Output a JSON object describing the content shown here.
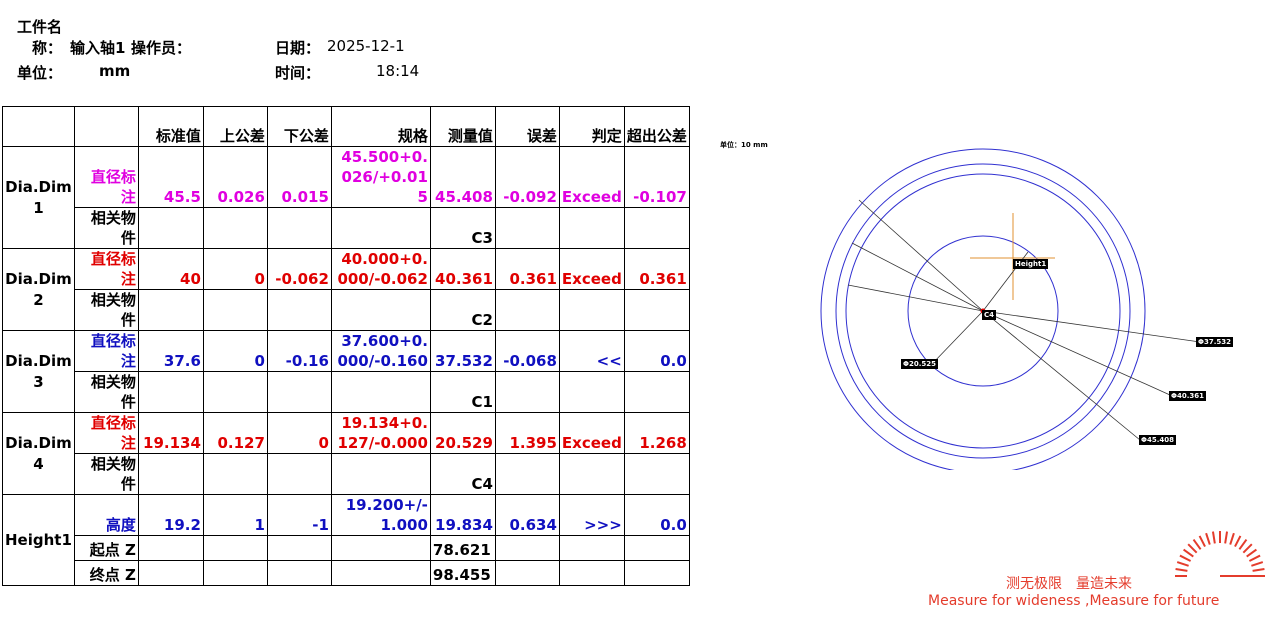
{
  "header": {
    "part_name_label": "工件名",
    "part_name_label2": "称：",
    "part_name": "输入轴1",
    "operator_label": "操作员：",
    "operator": "",
    "date_label": "日期：",
    "date": "2025-12-1",
    "unit_label": "单位：",
    "unit": "mm",
    "time_label": "时间：",
    "time": "18:14"
  },
  "table": {
    "headers": [
      "",
      "",
      "标准值",
      "上公差",
      "下公差",
      "规格",
      "测量值",
      "误差",
      "判定",
      "超出公差"
    ],
    "rows": [
      {
        "name": "Dia.Dim1",
        "label": "直径标注",
        "color": "mag",
        "std": "45.5",
        "up": "0.026",
        "low": "0.015",
        "spec": "45.500+0.026/+0.015",
        "meas": "45.408",
        "err": "-0.092",
        "judge": "Exceed",
        "exceed": "-0.107",
        "rel_label": "相关物件",
        "rel_value": "C3"
      },
      {
        "name": "Dia.Dim2",
        "label": "直径标注",
        "color": "red",
        "std": "40",
        "up": "0",
        "low": "-0.062",
        "spec": "40.000+0.000/-0.062",
        "meas": "40.361",
        "err": "0.361",
        "judge": "Exceed",
        "exceed": "0.361",
        "rel_label": "相关物件",
        "rel_value": "C2"
      },
      {
        "name": "Dia.Dim3",
        "label": "直径标注",
        "color": "blue",
        "std": "37.6",
        "up": "0",
        "low": "-0.16",
        "spec": "37.600+0.000/-0.160",
        "meas": "37.532",
        "err": "-0.068",
        "judge": "<<",
        "exceed": "0.0",
        "rel_label": "相关物件",
        "rel_value": "C1"
      },
      {
        "name": "Dia.Dim4",
        "label": "直径标注",
        "color": "red",
        "std": "19.134",
        "up": "0.127",
        "low": "0",
        "spec": "19.134+0.127/-0.000",
        "meas": "20.529",
        "err": "1.395",
        "judge": "Exceed",
        "exceed": "1.268",
        "rel_label": "相关物件",
        "rel_value": "C4"
      }
    ],
    "height": {
      "name": "Height1",
      "label": "高度",
      "std": "19.2",
      "up": "1",
      "low": "-1",
      "spec": "19.200+/-1.000",
      "meas": "19.834",
      "err": "0.634",
      "judge": ">>>",
      "exceed": "0.0",
      "start_label": "起点 Z",
      "start_value": "78.621",
      "end_label": "终点 Z",
      "end_value": "98.455"
    }
  },
  "drawing": {
    "unit_label": "单位：10 mm",
    "center_tag": "C4",
    "height_tag": "Height1",
    "dims": [
      "Φ37.532",
      "Φ40.361",
      "Φ45.408",
      "Φ20.525"
    ],
    "circle_color": "#3030d0"
  },
  "slogan": {
    "cn": "测无极限　量造未来",
    "en": "Measure for wideness  ,Measure for future",
    "color": "#e43c2c"
  }
}
